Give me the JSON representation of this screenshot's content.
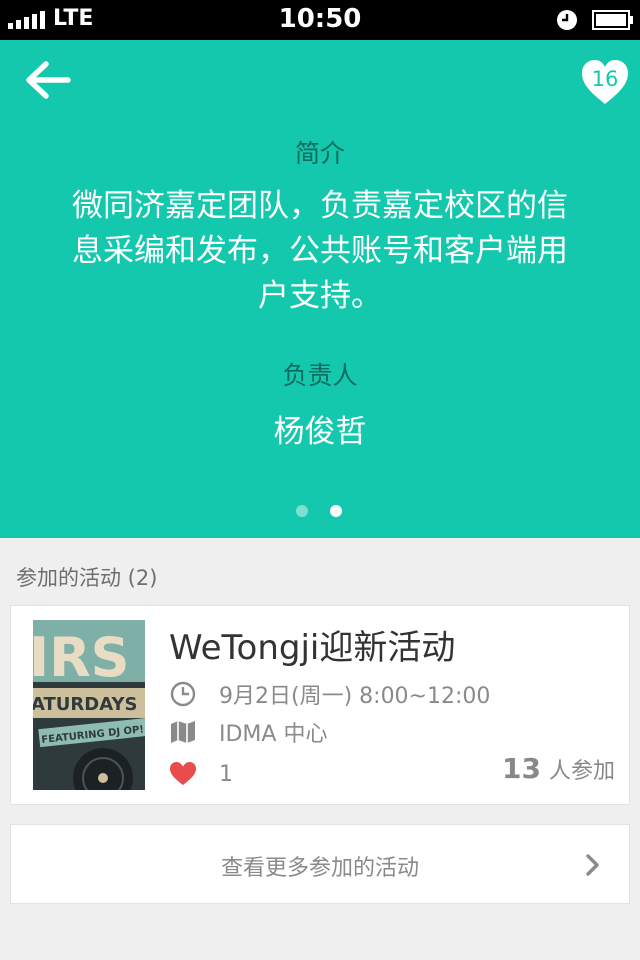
{
  "status_bar": {
    "carrier": "LTE",
    "time": "10:50"
  },
  "header": {
    "back_icon": "arrow-left-icon",
    "favorite_icon": "heart-icon",
    "favorite_count": "16"
  },
  "profile": {
    "intro_label": "简介",
    "intro_text": "微同济嘉定团队，负责嘉定校区的信息采编和发布，公共账号和客户端用户支持。",
    "owner_label": "负责人",
    "owner_name": "杨俊哲",
    "pager": {
      "total": 2,
      "active": 2
    }
  },
  "activities": {
    "section_title": "参加的活动 (2)",
    "items": [
      {
        "title": "WeTongji迎新活动",
        "time": "9月2日(周一) 8:00~12:00",
        "location": "IDMA 中心",
        "likes": "1",
        "participants": "13",
        "participants_unit": "人参加",
        "thumbnail_text": [
          "IRS",
          "ATURDAYS",
          "FEATURING DJ OP!"
        ]
      }
    ],
    "more_label": "查看更多参加的活动"
  },
  "colors": {
    "accent": "#14c8ad",
    "accent_dark_text": "#0b6b5d",
    "like": "#e84c4c",
    "background": "#efefef"
  }
}
